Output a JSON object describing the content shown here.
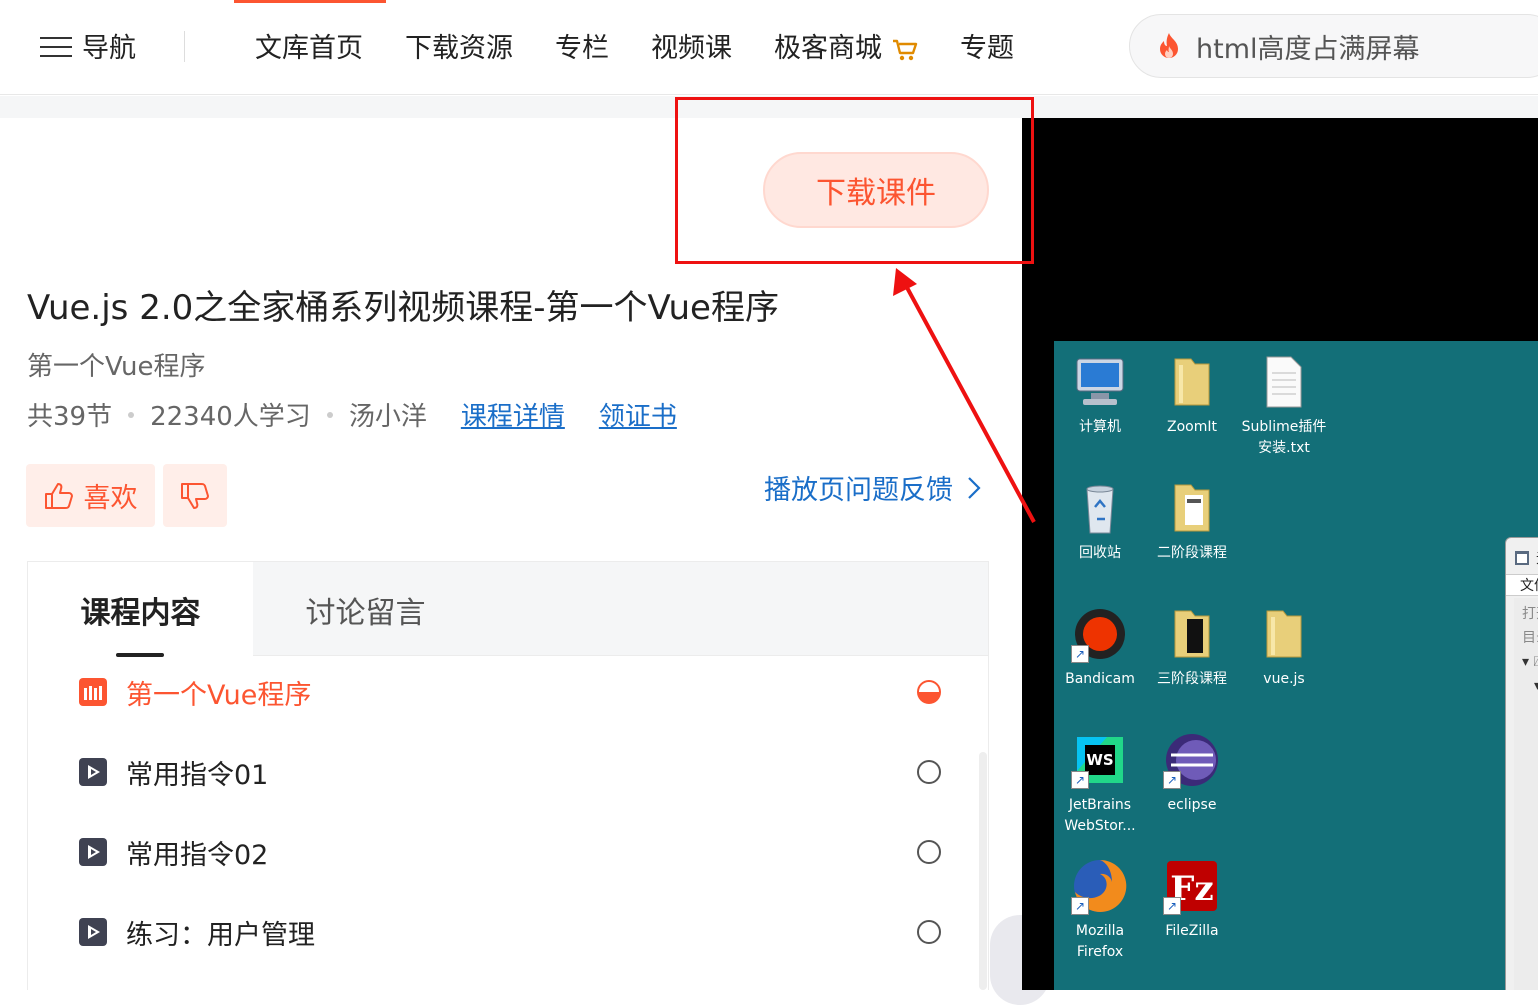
{
  "nav": {
    "menu_label": "导航",
    "links": [
      "文库首页",
      "下载资源",
      "专栏",
      "视频课",
      "极客商城",
      "专题"
    ],
    "search_value": "html高度占满屏幕"
  },
  "course": {
    "download_label": "下载课件",
    "title": "Vue.js 2.0之全家桶系列视频课程-第一个Vue程序",
    "subtitle": "第一个Vue程序",
    "sections": "共39节",
    "learners": "22340人学习",
    "author": "汤小洋",
    "detail_link": "课程详情",
    "cert_link": "领证书",
    "like_label": "喜欢",
    "feedback_label": "播放页问题反馈"
  },
  "tabs": [
    "课程内容",
    "讨论留言"
  ],
  "lessons": [
    {
      "title": "第一个Vue程序",
      "state": "playing"
    },
    {
      "title": "常用指令01",
      "state": "unwatched"
    },
    {
      "title": "常用指令02",
      "state": "unwatched"
    },
    {
      "title": "练习：用户管理",
      "state": "unwatched"
    }
  ],
  "desktop": {
    "icons": [
      {
        "label": "计算机",
        "icon": "computer-icon"
      },
      {
        "label": "ZoomIt",
        "icon": "folder-icon"
      },
      {
        "label": "Sublime插件\n安装.txt",
        "icon": "text-file-icon"
      },
      {
        "label": "回收站",
        "icon": "recycle-bin-icon"
      },
      {
        "label": "二阶段课程",
        "icon": "folder-icon"
      },
      {
        "label": "Bandicam",
        "icon": "bandicam-icon"
      },
      {
        "label": "三阶段课程",
        "icon": "folder-icon"
      },
      {
        "label": "vue.js",
        "icon": "folder-icon"
      },
      {
        "label": "JetBrains\nWebStor...",
        "icon": "webstorm-icon"
      },
      {
        "label": "eclipse",
        "icon": "eclipse-icon"
      },
      {
        "label": "Mozilla\nFirefox",
        "icon": "firefox-icon"
      },
      {
        "label": "FileZilla",
        "icon": "filezilla-icon"
      }
    ],
    "window": {
      "title": "无标",
      "menu": "文件(F)",
      "sidebar": [
        "打开文",
        "目录"
      ]
    }
  },
  "colors": {
    "accent": "#fc5531",
    "link": "#1a6ec8",
    "highlight": "#e11111",
    "desktop": "#136f78"
  }
}
